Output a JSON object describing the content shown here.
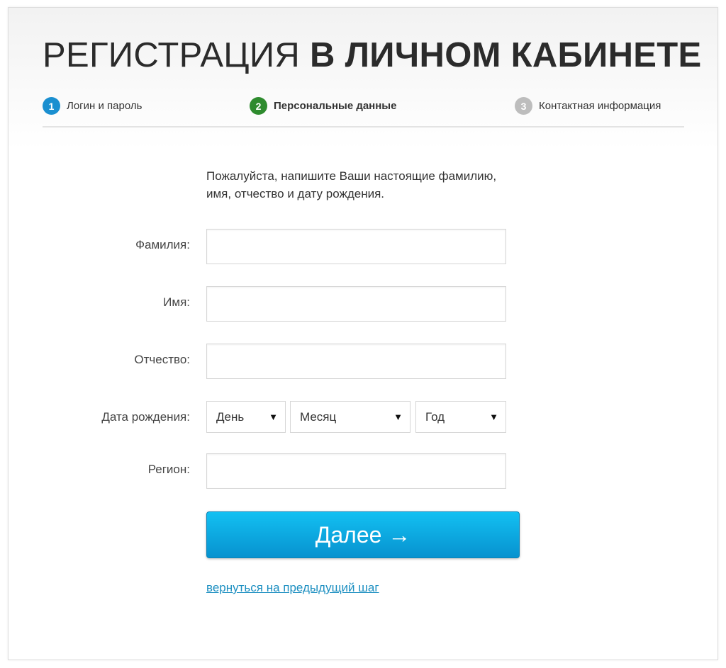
{
  "title": {
    "light": "РЕГИСТРАЦИЯ",
    "bold": "В ЛИЧНОМ КАБИНЕТЕ"
  },
  "steps": [
    {
      "num": "1",
      "label": "Логин и пароль",
      "color": "#1a8fd0",
      "state": "done"
    },
    {
      "num": "2",
      "label": "Персональные данные",
      "color": "#2e8b2e",
      "state": "current"
    },
    {
      "num": "3",
      "label": "Контактная информация",
      "color": "#bdbdbd",
      "state": "upcoming"
    }
  ],
  "intro": {
    "line1": "Пожалуйста, напишите Ваши настоящие фамилию,",
    "line2": "имя, отчество и дату рождения."
  },
  "fields": {
    "surname": "Фамилия:",
    "name": "Имя:",
    "patronymic": "Отчество:",
    "birthdate": "Дата рождения:",
    "region": "Регион:"
  },
  "birthdate": {
    "day": "День",
    "month": "Месяц",
    "year": "Год"
  },
  "next_button": "Далее →",
  "back_link": "вернуться на предыдущий шаг"
}
